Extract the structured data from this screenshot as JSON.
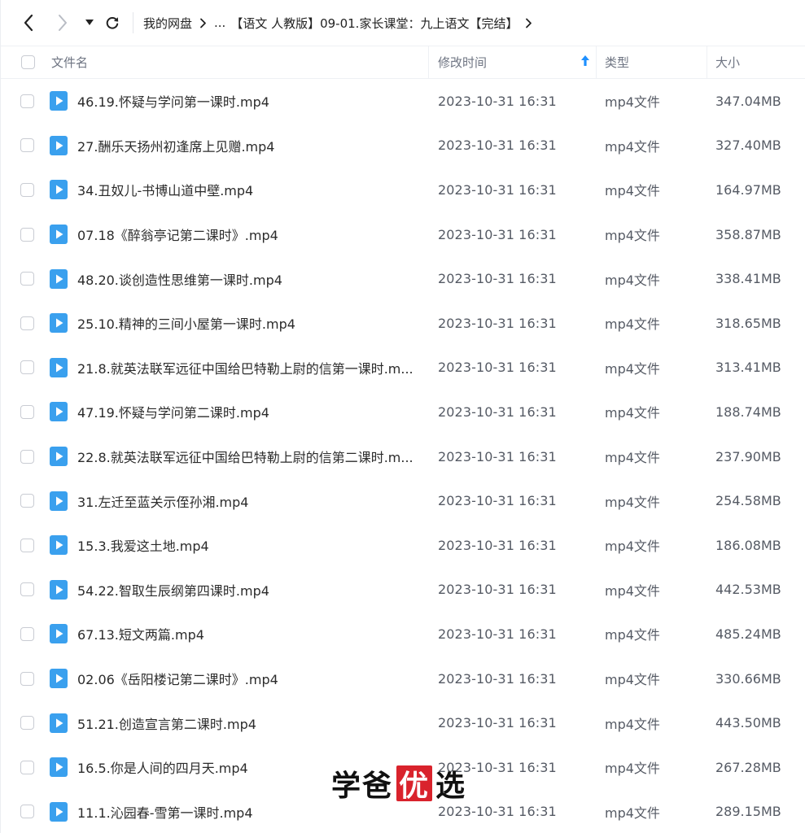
{
  "toolbar": {
    "breadcrumb": {
      "root": "我的网盘",
      "ellipsis": "...",
      "current": "【语文 人教版】09-01.家长课堂：九上语文【完结】"
    }
  },
  "table": {
    "columns": {
      "name": "文件名",
      "mtime": "修改时间",
      "type": "类型",
      "size": "大小"
    },
    "sort": "mtime-ascending",
    "colors": {
      "accent": "#1e90ff",
      "file_icon": "#3aa0ee"
    },
    "rows": [
      {
        "name": "46.19.怀疑与学问第一课时.mp4",
        "mtime": "2023-10-31 16:31",
        "type": "mp4文件",
        "size": "347.04MB"
      },
      {
        "name": "27.酬乐天扬州初逢席上见赠.mp4",
        "mtime": "2023-10-31 16:31",
        "type": "mp4文件",
        "size": "327.40MB"
      },
      {
        "name": "34.丑奴儿-书博山道中壁.mp4",
        "mtime": "2023-10-31 16:31",
        "type": "mp4文件",
        "size": "164.97MB"
      },
      {
        "name": "07.18《醉翁亭记第二课时》.mp4",
        "mtime": "2023-10-31 16:31",
        "type": "mp4文件",
        "size": "358.87MB"
      },
      {
        "name": "48.20.谈创造性思维第一课时.mp4",
        "mtime": "2023-10-31 16:31",
        "type": "mp4文件",
        "size": "338.41MB"
      },
      {
        "name": "25.10.精神的三间小屋第一课时.mp4",
        "mtime": "2023-10-31 16:31",
        "type": "mp4文件",
        "size": "318.65MB"
      },
      {
        "name": "21.8.就英法联军远征中国给巴特勒上尉的信第一课时.m...",
        "mtime": "2023-10-31 16:31",
        "type": "mp4文件",
        "size": "313.41MB"
      },
      {
        "name": "47.19.怀疑与学问第二课时.mp4",
        "mtime": "2023-10-31 16:31",
        "type": "mp4文件",
        "size": "188.74MB"
      },
      {
        "name": "22.8.就英法联军远征中国给巴特勒上尉的信第二课时.m...",
        "mtime": "2023-10-31 16:31",
        "type": "mp4文件",
        "size": "237.90MB"
      },
      {
        "name": "31.左迁至蓝关示侄孙湘.mp4",
        "mtime": "2023-10-31 16:31",
        "type": "mp4文件",
        "size": "254.58MB"
      },
      {
        "name": "15.3.我爱这土地.mp4",
        "mtime": "2023-10-31 16:31",
        "type": "mp4文件",
        "size": "186.08MB"
      },
      {
        "name": "54.22.智取生辰纲第四课时.mp4",
        "mtime": "2023-10-31 16:31",
        "type": "mp4文件",
        "size": "442.53MB"
      },
      {
        "name": "67.13.短文两篇.mp4",
        "mtime": "2023-10-31 16:31",
        "type": "mp4文件",
        "size": "485.24MB"
      },
      {
        "name": "02.06《岳阳楼记第二课时》.mp4",
        "mtime": "2023-10-31 16:31",
        "type": "mp4文件",
        "size": "330.66MB"
      },
      {
        "name": "51.21.创造宣言第二课时.mp4",
        "mtime": "2023-10-31 16:31",
        "type": "mp4文件",
        "size": "443.50MB"
      },
      {
        "name": "16.5.你是人间的四月天.mp4",
        "mtime": "2023-10-31 16:31",
        "type": "mp4文件",
        "size": "267.28MB"
      },
      {
        "name": "11.1.沁园春-雪第一课时.mp4",
        "mtime": "2023-10-31 16:31",
        "type": "mp4文件",
        "size": "289.15MB"
      }
    ]
  },
  "watermark": {
    "before": "学爸",
    "boxed": "优",
    "after": "选"
  }
}
